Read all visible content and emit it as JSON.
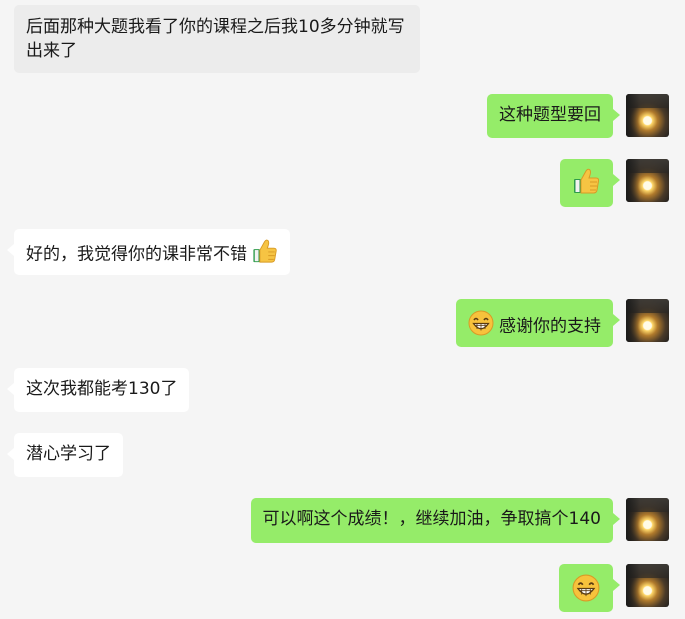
{
  "messages": [
    {
      "side": "in",
      "text": "后面那种大题我看了你的课程之后我10多分钟就写出来了"
    },
    {
      "side": "out",
      "text": "这种题型要回"
    },
    {
      "side": "out",
      "text": "",
      "emoji": "thumbs-up-icon"
    },
    {
      "side": "in",
      "text": "好的，我觉得你的课非常不错",
      "emoji": "thumbs-up-icon"
    },
    {
      "side": "out",
      "text": "感谢你的支持",
      "emoji": "grinning-face-icon"
    },
    {
      "side": "in",
      "text": "这次我都能考130了"
    },
    {
      "side": "in",
      "text": "潜心学习了"
    },
    {
      "side": "out",
      "text": "可以啊这个成绩！，继续加油，争取搞个140"
    },
    {
      "side": "out",
      "text": "",
      "emoji": "grinning-face-icon"
    }
  ],
  "colors": {
    "background": "#f5f5f5",
    "incoming_bubble": "#ffffff",
    "outgoing_bubble": "#95ec69"
  }
}
